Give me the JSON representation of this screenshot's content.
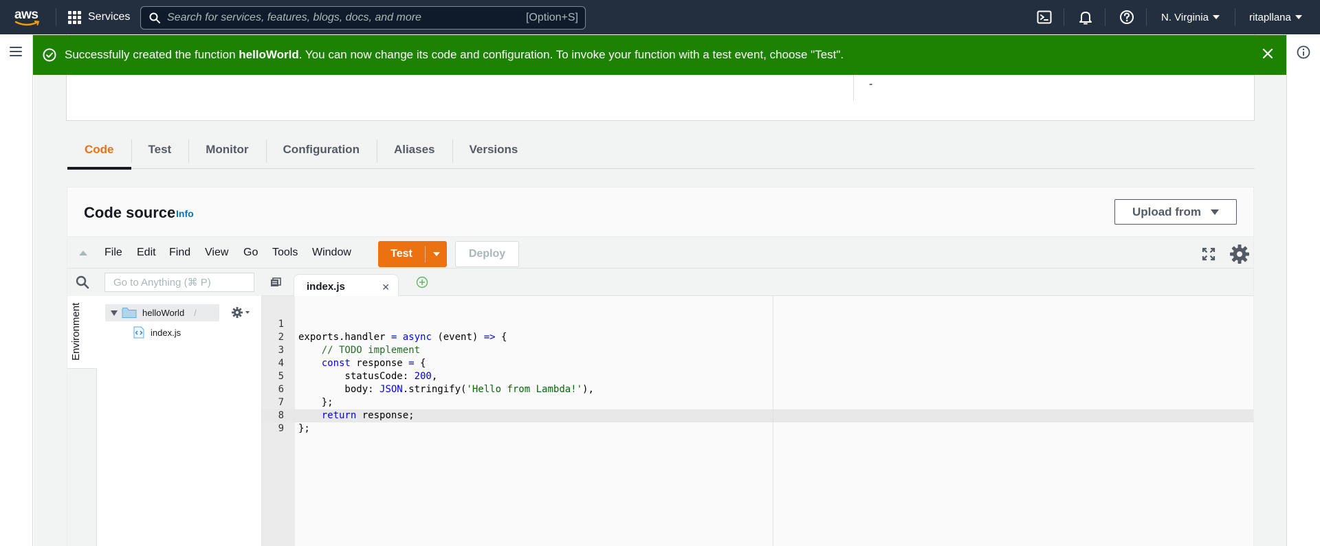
{
  "topnav": {
    "logo_text": "aws",
    "services_label": "Services",
    "search_placeholder": "Search for services, features, blogs, docs, and more",
    "search_shortcut": "[Option+S]",
    "region": "N. Virginia",
    "user": "ritapllana",
    "bg_color": "#232f3e"
  },
  "flash": {
    "prefix": "Successfully created the function ",
    "function_name": "helloWorld",
    "suffix": ". You can now change its code and configuration. To invoke your function with a test event, choose \"Test\".",
    "color": "#1d8102"
  },
  "summary": {
    "value_dash": "-"
  },
  "tabs": [
    {
      "label": "Code",
      "active": true
    },
    {
      "label": "Test"
    },
    {
      "label": "Monitor"
    },
    {
      "label": "Configuration"
    },
    {
      "label": "Aliases"
    },
    {
      "label": "Versions"
    }
  ],
  "code_source": {
    "title": "Code source",
    "info_link": "Info",
    "upload_label": "Upload from"
  },
  "ide": {
    "menu": [
      "File",
      "Edit",
      "Find",
      "View",
      "Go",
      "Tools",
      "Window"
    ],
    "test_label": "Test",
    "deploy_label": "Deploy",
    "goto_placeholder": "Go to Anything (⌘ P)",
    "environment_label": "Environment",
    "tree": {
      "root": "helloWorld",
      "root_suffix": "/",
      "file": "index.js"
    },
    "open_tab": "index.js",
    "code_lines": [
      {
        "n": "1",
        "text": "exports.handler = async (event) => {"
      },
      {
        "n": "2",
        "text": "    // TODO implement"
      },
      {
        "n": "3",
        "text": "    const response = {"
      },
      {
        "n": "4",
        "text": "        statusCode: 200,"
      },
      {
        "n": "5",
        "text": "        body: JSON.stringify('Hello from Lambda!'),"
      },
      {
        "n": "6",
        "text": "    };"
      },
      {
        "n": "7",
        "text": "    return response;"
      },
      {
        "n": "8",
        "text": "};"
      },
      {
        "n": "9",
        "text": ""
      }
    ]
  },
  "colors": {
    "accent": "#ec7211",
    "link": "#0073bb"
  }
}
